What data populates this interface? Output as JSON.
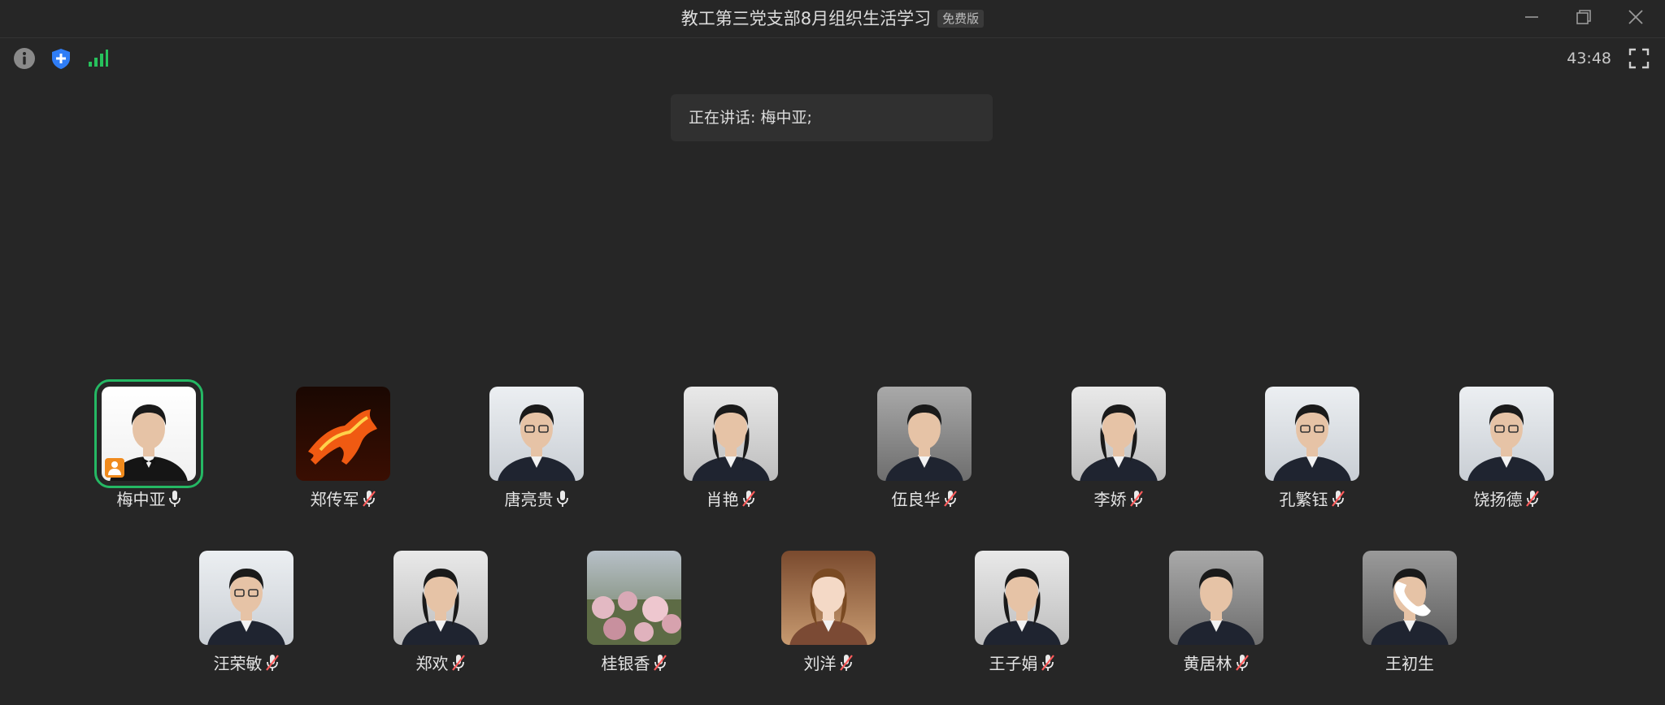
{
  "window": {
    "title": "教工第三党支部8月组织生活学习",
    "badge": "免费版"
  },
  "toolbar": {
    "timer": "43:48"
  },
  "status": {
    "speaking_text": "正在讲话: 梅中亚;"
  },
  "colors": {
    "background": "#262626",
    "active_speaker_ring": "#25b864",
    "shield_blue": "#2f7df6",
    "signal_green": "#27c15c",
    "badge_orange": "#f08a1c"
  },
  "participants_row1": [
    {
      "name": "梅中亚",
      "mic": "on",
      "avatar": "photo-man-bowtie",
      "active": true
    },
    {
      "name": "郑传军",
      "mic": "muted",
      "avatar": "fire-horse"
    },
    {
      "name": "唐亮贵",
      "mic": "on",
      "avatar": "photo-man-glasses"
    },
    {
      "name": "肖艳",
      "mic": "muted",
      "avatar": "photo-woman"
    },
    {
      "name": "伍良华",
      "mic": "muted",
      "avatar": "photo-man-suit"
    },
    {
      "name": "李娇",
      "mic": "muted",
      "avatar": "photo-woman"
    },
    {
      "name": "孔繁钰",
      "mic": "muted",
      "avatar": "photo-man-glasses"
    },
    {
      "name": "饶扬德",
      "mic": "muted",
      "avatar": "photo-man-glasses"
    }
  ],
  "participants_row2": [
    {
      "name": "汪荣敏",
      "mic": "muted",
      "avatar": "photo-man-glasses"
    },
    {
      "name": "郑欢",
      "mic": "muted",
      "avatar": "photo-woman"
    },
    {
      "name": "桂银香",
      "mic": "muted",
      "avatar": "landscape-blossom"
    },
    {
      "name": "刘洋",
      "mic": "muted",
      "avatar": "illustration-woman"
    },
    {
      "name": "王子娟",
      "mic": "muted",
      "avatar": "photo-woman"
    },
    {
      "name": "黄居林",
      "mic": "muted",
      "avatar": "photo-man-suit"
    },
    {
      "name": "王初生",
      "mic": "phone",
      "avatar": "photo-man-phone"
    }
  ]
}
